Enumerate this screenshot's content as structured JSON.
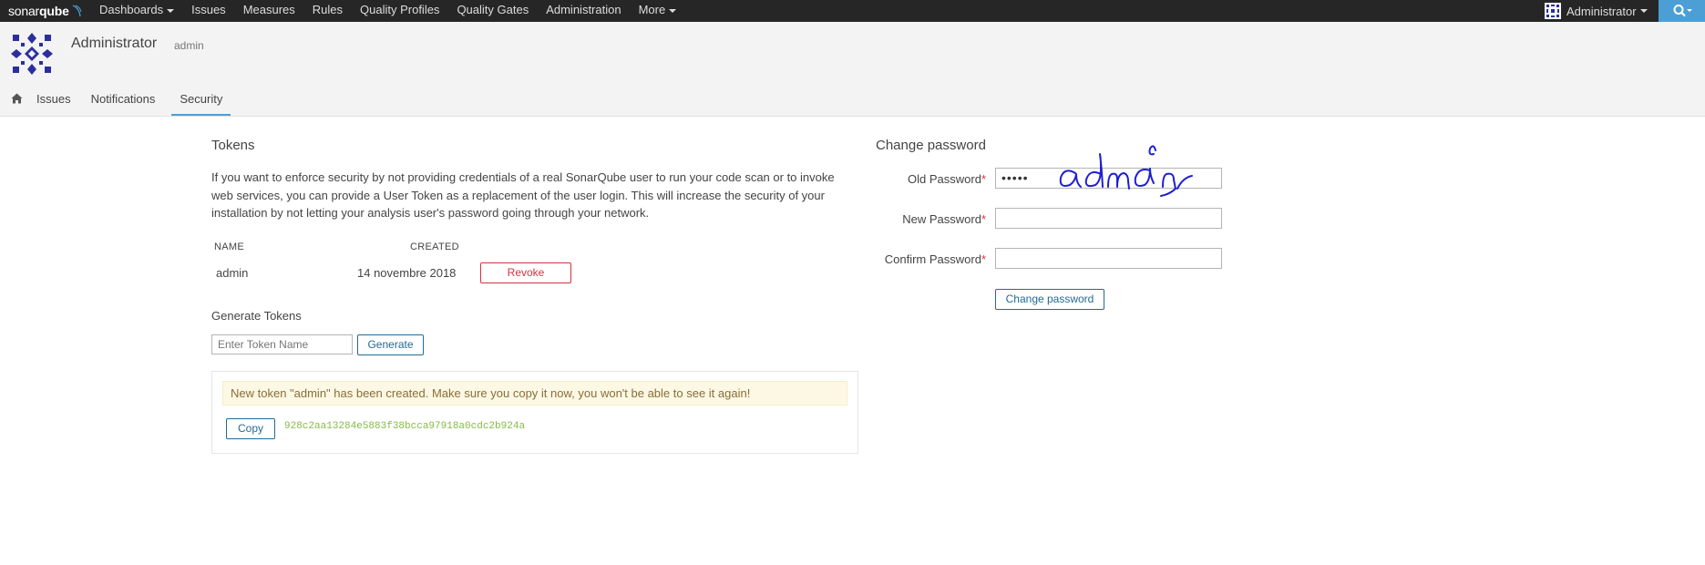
{
  "navbar": {
    "logo_left": "sonar",
    "logo_right": "qube",
    "items": [
      {
        "label": "Dashboards",
        "dropdown": true
      },
      {
        "label": "Issues",
        "dropdown": false
      },
      {
        "label": "Measures",
        "dropdown": false
      },
      {
        "label": "Rules",
        "dropdown": false
      },
      {
        "label": "Quality Profiles",
        "dropdown": false
      },
      {
        "label": "Quality Gates",
        "dropdown": false
      },
      {
        "label": "Administration",
        "dropdown": false
      },
      {
        "label": "More",
        "dropdown": true
      }
    ],
    "user": "Administrator",
    "search_icon": "search-icon"
  },
  "header": {
    "name": "Administrator",
    "login": "admin",
    "tabs": [
      {
        "label": "Issues"
      },
      {
        "label": "Notifications"
      },
      {
        "label": "Security"
      }
    ],
    "home_icon": "home-icon"
  },
  "tokens": {
    "title": "Tokens",
    "description": "If you want to enforce security by not providing credentials of a real SonarQube user to run your code scan or to invoke web services, you can provide a User Token as a replacement of the user login. This will increase the security of your installation by not letting your analysis user's password going through your network.",
    "columns": {
      "name": "NAME",
      "created": "CREATED"
    },
    "rows": [
      {
        "name": "admin",
        "created": "14 novembre 2018",
        "action": "Revoke"
      }
    ],
    "generate_title": "Generate Tokens",
    "generate_placeholder": "Enter Token Name",
    "generate_button": "Generate",
    "alert": "New token \"admin\" has been created. Make sure you copy it now, you won't be able to see it again!",
    "copy_button": "Copy",
    "token_value": "928c2aa13284e5883f38bcca97918a0cdc2b924a"
  },
  "password": {
    "title": "Change password",
    "old_label": "Old Password",
    "old_value": "•••••",
    "new_label": "New Password",
    "confirm_label": "Confirm Password",
    "required_mark": "*",
    "submit": "Change password"
  },
  "colors": {
    "navbar": "#262626",
    "accent": "#4b9fd5",
    "danger": "#d4333f",
    "button": "#236a97",
    "token": "#85bb43",
    "annotation_ink": "#1f1fd1"
  }
}
